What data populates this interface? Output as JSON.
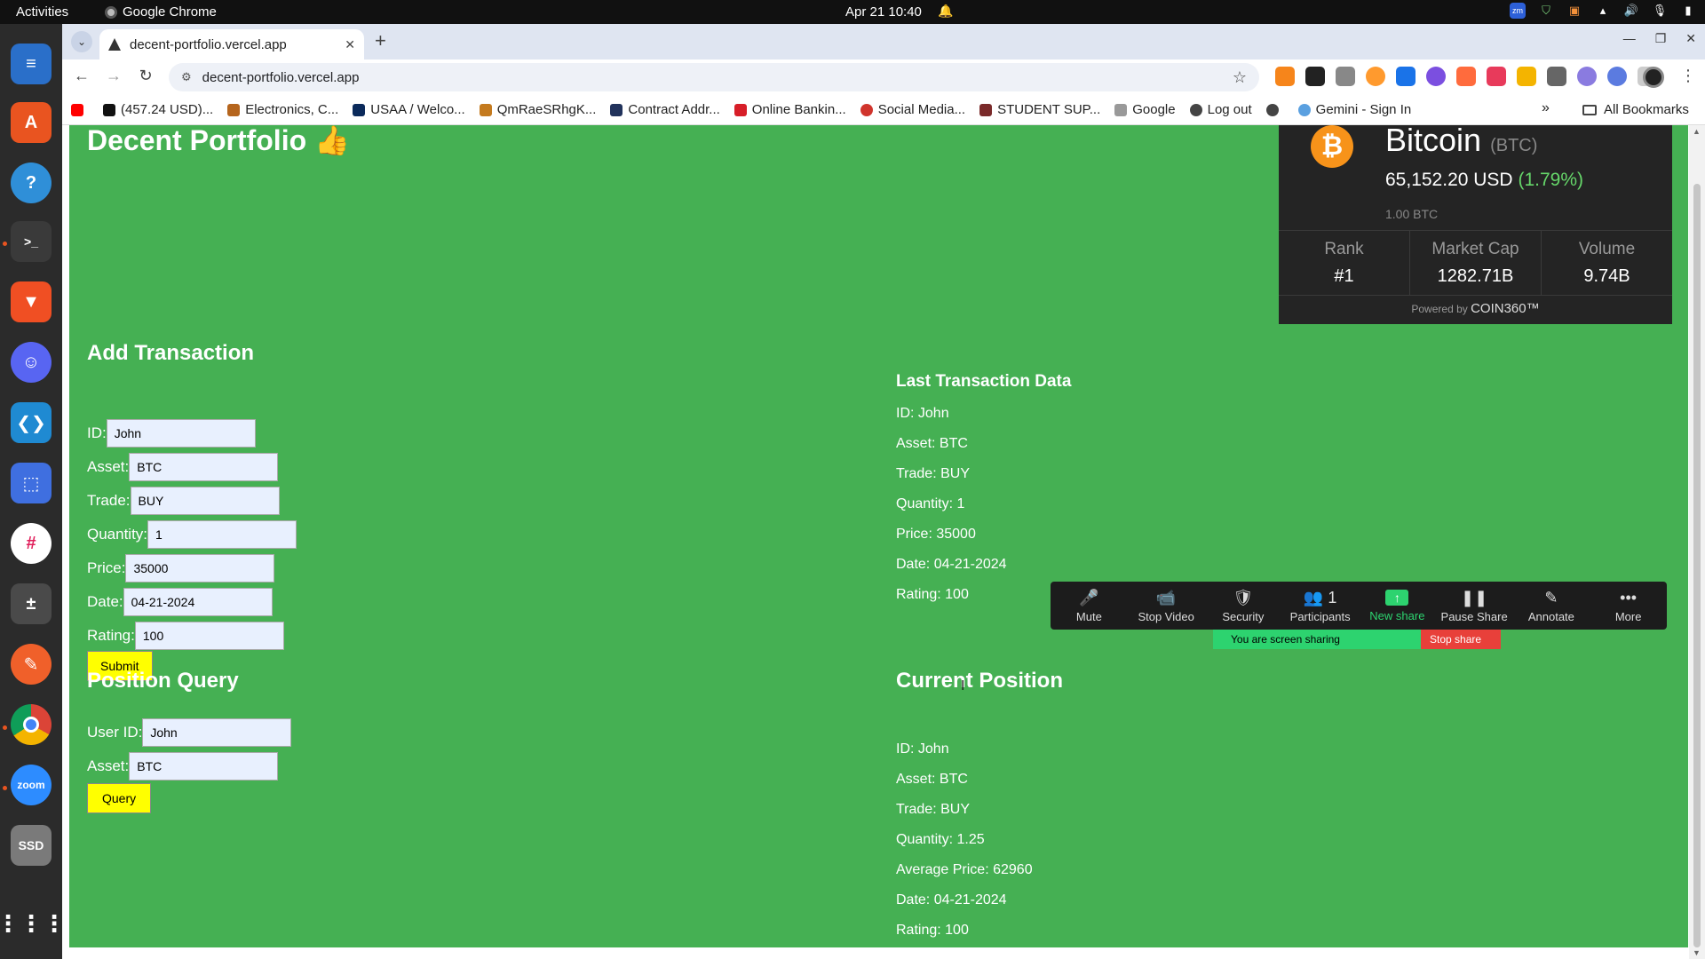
{
  "topbar": {
    "activities": "Activities",
    "app_name": "Google Chrome",
    "clock": "Apr 21  10:40"
  },
  "dock": {
    "items": [
      {
        "name": "libreoffice-writer-icon",
        "color": "#2a6fc9"
      },
      {
        "name": "app-center-icon",
        "color": "#e95420"
      },
      {
        "name": "help-icon",
        "color": "#2f8fd8"
      },
      {
        "name": "terminal-icon",
        "color": "#3a3a3a"
      },
      {
        "name": "brave-icon",
        "color": "#f04f23"
      },
      {
        "name": "discord-icon",
        "color": "#5865f2"
      },
      {
        "name": "vscode-icon",
        "color": "#1f8ad2"
      },
      {
        "name": "screenshot-icon",
        "color": "#3f6fe0"
      },
      {
        "name": "slack-icon",
        "color": "#ffffff"
      },
      {
        "name": "calculator-icon",
        "color": "#4a4a4a"
      },
      {
        "name": "pen-icon",
        "color": "#f0602a"
      },
      {
        "name": "chrome-icon",
        "color": "#ffffff"
      },
      {
        "name": "zoom-icon",
        "color": "#2d8cff"
      },
      {
        "name": "ssd-drive-icon",
        "color": "#7a7a7a"
      }
    ],
    "zoom_label": "zoom",
    "ssd_label": "SSD"
  },
  "browser": {
    "tab_title": "decent-portfolio.vercel.app",
    "url": "decent-portfolio.vercel.app",
    "bookmarks": [
      {
        "label": "",
        "color": "#ff0000"
      },
      {
        "label": "(457.24 USD)...",
        "color": "#111111"
      },
      {
        "label": "Electronics, C...",
        "color": "#b5651d"
      },
      {
        "label": "USAA / Welco...",
        "color": "#0b2a5b"
      },
      {
        "label": "QmRaeSRhgK...",
        "color": "#c47a1e"
      },
      {
        "label": "Contract Addr...",
        "color": "#21325b"
      },
      {
        "label": "Online Bankin...",
        "color": "#d71e28"
      },
      {
        "label": "Social Media...",
        "color": "#d0342c"
      },
      {
        "label": "STUDENT SUP...",
        "color": "#7a2a2a"
      },
      {
        "label": "Google",
        "color": "#999999"
      },
      {
        "label": "Log out",
        "color": "#444444"
      },
      {
        "label": "",
        "color": "#444444"
      },
      {
        "label": "Gemini - Sign In",
        "color": "#5aa0e0"
      }
    ],
    "all_bookmarks": "All Bookmarks"
  },
  "page": {
    "title": "Decent Portfolio 👍",
    "add_transaction": {
      "heading": "Add Transaction",
      "fields": [
        {
          "label": "ID:",
          "value": "John"
        },
        {
          "label": "Asset:",
          "value": "BTC"
        },
        {
          "label": "Trade:",
          "value": "BUY"
        },
        {
          "label": "Quantity:",
          "value": "1"
        },
        {
          "label": "Price:",
          "value": "35000"
        },
        {
          "label": "Date:",
          "value": "04-21-2024"
        },
        {
          "label": "Rating:",
          "value": "100"
        }
      ],
      "submit_label": "Submit"
    },
    "position_query": {
      "heading": "Position Query",
      "fields": [
        {
          "label": "User ID:",
          "value": "John"
        },
        {
          "label": "Asset:",
          "value": "BTC"
        }
      ],
      "query_label": "Query"
    },
    "last_transaction": {
      "heading": "Last Transaction Data",
      "lines": [
        "ID: John",
        "Asset: BTC",
        "Trade: BUY",
        "Quantity: 1",
        "Price: 35000",
        "Date: 04-21-2024",
        "Rating: 100"
      ]
    },
    "current_position": {
      "heading": "Current Position",
      "lines": [
        "ID: John",
        "Asset: BTC",
        "Trade: BUY",
        "Quantity: 1.25",
        "Average Price: 62960",
        "Date: 04-21-2024",
        "Rating: 100"
      ]
    }
  },
  "coin_widget": {
    "logo": "₿",
    "name": "Bitcoin",
    "symbol": "(BTC)",
    "price": "65,152.20 USD",
    "change": "(1.79%)",
    "amount": "1.00 BTC",
    "stats": [
      {
        "label": "Rank",
        "value": "#1"
      },
      {
        "label": "Market Cap",
        "value": "1282.71B"
      },
      {
        "label": "Volume",
        "value": "9.74B"
      }
    ],
    "powered_by": "Powered by",
    "brand": "COIN360™"
  },
  "zoom": {
    "buttons": [
      {
        "name": "mute-button",
        "icon": "🎤",
        "label": "Mute"
      },
      {
        "name": "stop-video-button",
        "icon": "📹",
        "label": "Stop Video"
      },
      {
        "name": "security-button",
        "icon": "🛡",
        "label": "Security"
      },
      {
        "name": "participants-button",
        "icon": "👥 1",
        "label": "Participants"
      },
      {
        "name": "new-share-button",
        "icon": "↑",
        "label": "New share"
      },
      {
        "name": "pause-share-button",
        "icon": "❚❚",
        "label": "Pause Share"
      },
      {
        "name": "annotate-button",
        "icon": "✎",
        "label": "Annotate"
      },
      {
        "name": "more-button",
        "icon": "•••",
        "label": "More"
      }
    ],
    "sharing_text": "You are screen sharing",
    "stop_share": "Stop share"
  }
}
